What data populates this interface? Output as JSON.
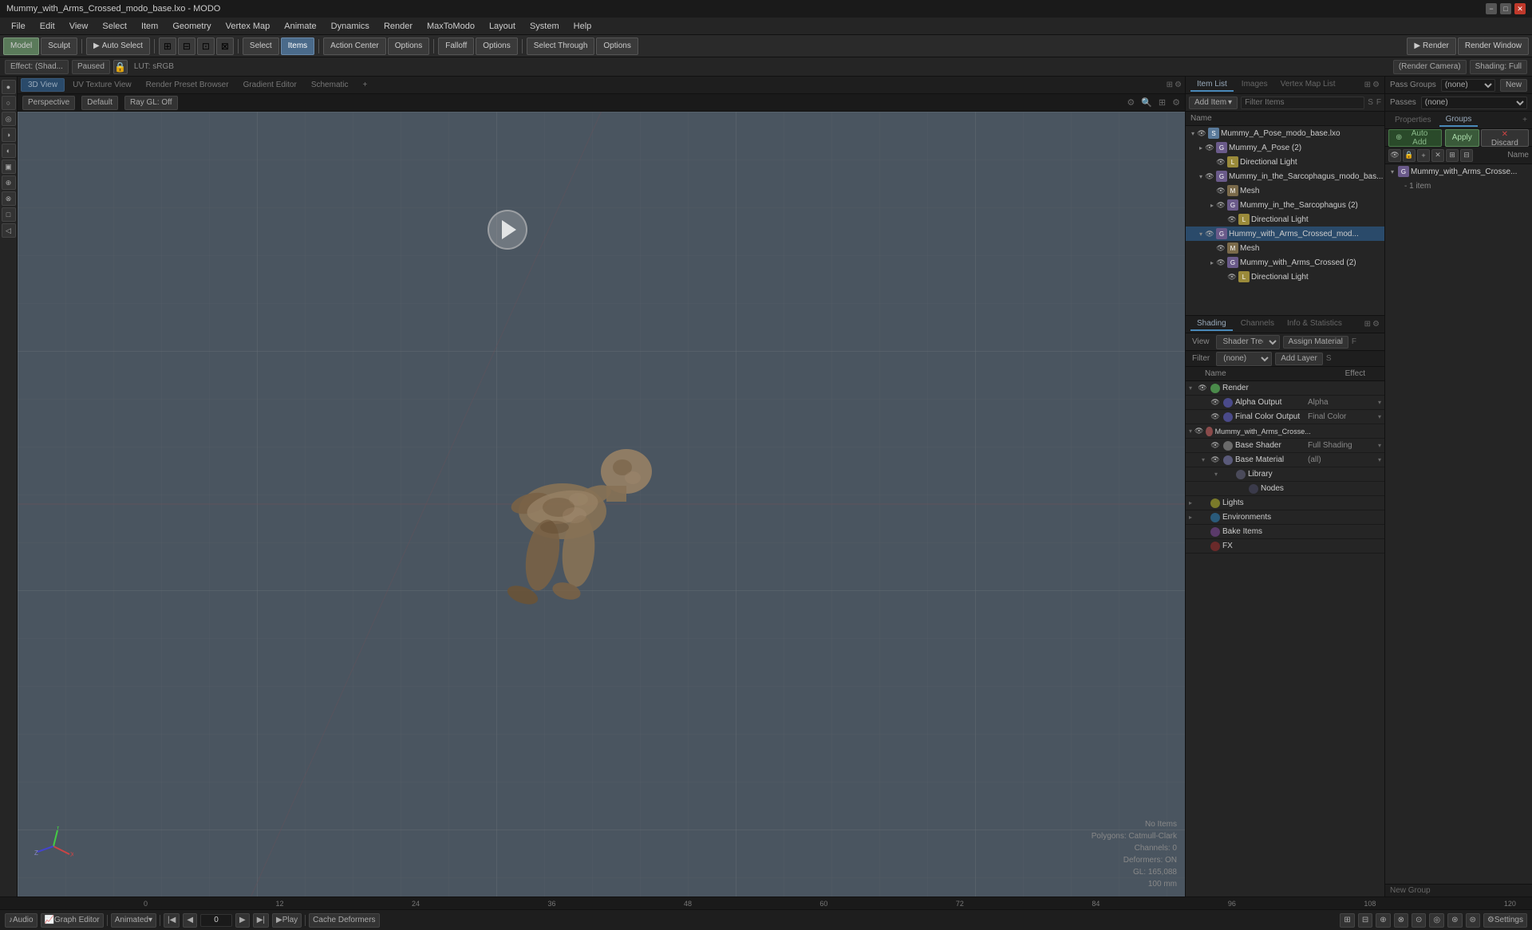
{
  "titlebar": {
    "title": "Mummy_with_Arms_Crossed_modo_base.lxo - MODO",
    "min": "−",
    "max": "□",
    "close": "✕"
  },
  "menubar": {
    "items": [
      "File",
      "Edit",
      "View",
      "Select",
      "Item",
      "Geometry",
      "Vertex Map",
      "Animate",
      "Dynamics",
      "Render",
      "MaxToModo",
      "Layout",
      "System",
      "Help"
    ]
  },
  "toolbar": {
    "model_btn": "Model",
    "sculpt_btn": "Sculpt",
    "auto_select": "Auto Select",
    "select_btn": "Select",
    "items_btn": "Items",
    "action_center_btn": "Action Center",
    "options_btn1": "Options",
    "falloff_btn": "Falloff",
    "options_btn2": "Options",
    "select_through": "Select Through",
    "options_btn3": "Options",
    "render_btn": "Render",
    "render_window_btn": "Render Window"
  },
  "toolbar2": {
    "effect_label": "Effect: (Shad...",
    "paused_btn": "Paused",
    "lut_label": "LUT: sRGB",
    "render_camera_btn": "(Render Camera)",
    "shading_btn": "Shading: Full"
  },
  "viewport_tabs": {
    "tab_3d": "3D View",
    "tab_uv": "UV Texture View",
    "tab_render": "Render Preset Browser",
    "tab_gradient": "Gradient Editor",
    "tab_schematic": "Schematic",
    "tab_add": "+"
  },
  "viewport_info": {
    "perspective": "Perspective",
    "default": "Default",
    "ray_gl": "Ray GL: Off"
  },
  "viewport_stats": {
    "no_items": "No Items",
    "polygons": "Polygons: Catmull-Clark",
    "channels": "Channels: 0",
    "deformers": "Deformers: ON",
    "gl_info": "GL: 165,088",
    "scale": "100 mm"
  },
  "item_list_panel": {
    "header_tabs": [
      "Item List",
      "Images",
      "Vertex Map List"
    ],
    "add_item_btn": "Add Item",
    "filter_placeholder": "Filter Items",
    "col_name": "Name",
    "s_label": "S",
    "f_label": "F",
    "items": [
      {
        "level": 0,
        "type": "scene",
        "name": "Mummy_A_Pose_modo_base.lxo",
        "expanded": true,
        "children": [
          {
            "level": 1,
            "type": "group",
            "name": "Mummy_A_Pose",
            "count": "(2)",
            "expanded": false
          },
          {
            "level": 2,
            "type": "light",
            "name": "Directional Light",
            "expanded": false
          },
          {
            "level": 1,
            "type": "group",
            "name": "Mummy_in_the_Sarcophagus_modo_bas...",
            "count": "",
            "expanded": true
          },
          {
            "level": 2,
            "type": "mesh",
            "name": "Mesh",
            "expanded": false
          },
          {
            "level": 2,
            "type": "group",
            "name": "Mummy_in_the_Sarcophagus",
            "count": "(2)",
            "expanded": false
          },
          {
            "level": 3,
            "type": "light",
            "name": "Directional Light",
            "expanded": false
          },
          {
            "level": 1,
            "type": "group",
            "name": "Hummy_with_Arms_Crossed_mod...",
            "count": "",
            "expanded": true,
            "selected": true
          },
          {
            "level": 2,
            "type": "mesh",
            "name": "Mesh",
            "expanded": false
          },
          {
            "level": 2,
            "type": "group",
            "name": "Mummy_with_Arms_Crossed",
            "count": "(2)",
            "expanded": false
          },
          {
            "level": 3,
            "type": "light",
            "name": "Directional Light",
            "expanded": false
          }
        ]
      }
    ]
  },
  "shading_panel": {
    "header_tabs": [
      "Shading",
      "Channels",
      "Info & Statistics"
    ],
    "view_label": "View",
    "shader_tree": "Shader Tree",
    "assign_material_btn": "Assign Material",
    "f_btn": "F",
    "filter_label": "Filter",
    "filter_value": "(none)",
    "add_layer_btn": "Add Layer",
    "s_btn": "S",
    "col_name": "Name",
    "col_effect": "Effect",
    "items": [
      {
        "indent": 0,
        "icon": "render",
        "label": "Render",
        "effect": "",
        "has_dropdown": false,
        "expanded": true
      },
      {
        "indent": 1,
        "icon": "output",
        "label": "Alpha Output",
        "effect": "Alpha",
        "has_dropdown": true
      },
      {
        "indent": 1,
        "icon": "output",
        "label": "Final Color Output",
        "effect": "Final Color",
        "has_dropdown": true
      },
      {
        "indent": 0,
        "icon": "material",
        "label": "Mummy_with_Arms_Crosse...",
        "effect": "",
        "has_dropdown": false,
        "expanded": true
      },
      {
        "indent": 1,
        "icon": "shader",
        "label": "Base Shader",
        "effect": "Full Shading",
        "has_dropdown": true
      },
      {
        "indent": 1,
        "icon": "base",
        "label": "Base Material",
        "effect": "(all)",
        "has_dropdown": true
      },
      {
        "indent": 2,
        "icon": "shader",
        "label": "Library",
        "effect": "",
        "has_dropdown": false
      },
      {
        "indent": 3,
        "icon": "shader",
        "label": "Nodes",
        "effect": "",
        "has_dropdown": false
      },
      {
        "indent": 0,
        "icon": "light",
        "label": "Lights",
        "effect": "",
        "has_dropdown": false,
        "collapsed": true
      },
      {
        "indent": 0,
        "icon": "env",
        "label": "Environments",
        "effect": "",
        "has_dropdown": false,
        "collapsed": true
      },
      {
        "indent": 0,
        "icon": "bake",
        "label": "Bake Items",
        "effect": "",
        "has_dropdown": false
      },
      {
        "indent": 0,
        "icon": "fx",
        "label": "FX",
        "effect": "",
        "has_dropdown": false
      }
    ]
  },
  "far_right_panel": {
    "pass_groups_label": "Pass Groups",
    "none_value": "(none)",
    "new_btn": "New",
    "passes_label": "Passes",
    "passes_value": "(none)",
    "properties_tab": "Properties",
    "groups_tab": "Groups",
    "new_group_label": "New Group",
    "group_name": "Mummy_with_Arms_Crosse...",
    "group_info": "- 1 item",
    "name_col": "Name",
    "auto_add_btn": "Auto Add",
    "apply_btn": "Apply",
    "discard_btn": "Discard"
  },
  "timeline": {
    "audio_btn": "Audio",
    "graph_editor_btn": "Graph Editor",
    "animated_btn": "Animated",
    "frame_value": "0",
    "play_btn": "Play",
    "cache_deformers_btn": "Cache Deformers",
    "settings_btn": "Settings",
    "start_frame": "0",
    "end_frame": "120",
    "ruler_marks": [
      "0",
      "12",
      "24",
      "36",
      "48",
      "60",
      "72",
      "84",
      "96",
      "108",
      "120"
    ]
  }
}
